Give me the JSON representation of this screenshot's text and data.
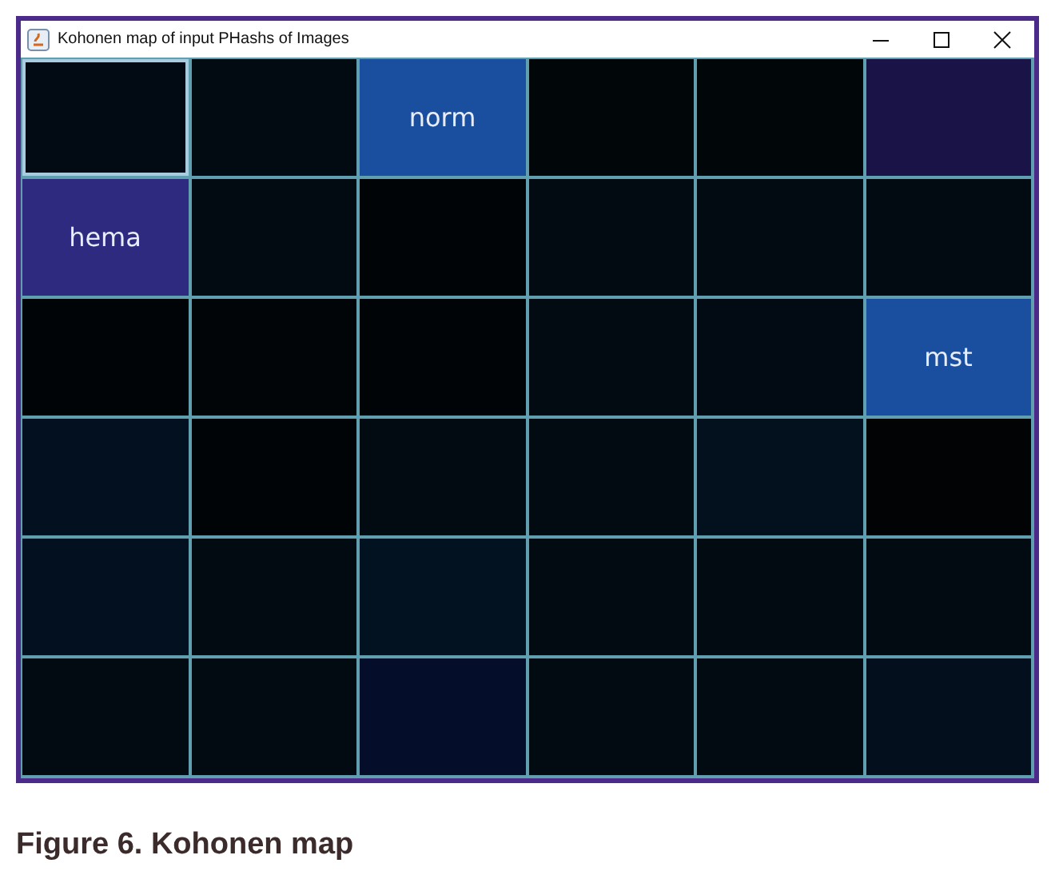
{
  "window": {
    "title": "Kohonen map of input PHashs of Images"
  },
  "map": {
    "rows": [
      [
        {
          "color": "#020b14",
          "selected": true
        },
        {
          "color": "#020a12",
          "selected": false
        },
        {
          "color": "#1a4fa0",
          "label": "norm",
          "selected": false
        },
        {
          "color": "#010609",
          "selected": false
        },
        {
          "color": "#010609",
          "selected": false
        },
        {
          "color": "#1a1347",
          "selected": false
        }
      ],
      [
        {
          "color": "#2e2a80",
          "label": "hema",
          "selected": false
        },
        {
          "color": "#020a12",
          "selected": false
        },
        {
          "color": "#010407",
          "selected": false
        },
        {
          "color": "#020a12",
          "selected": false
        },
        {
          "color": "#020a12",
          "selected": false
        },
        {
          "color": "#020a12",
          "selected": false
        }
      ],
      [
        {
          "color": "#010407",
          "selected": false
        },
        {
          "color": "#010508",
          "selected": false
        },
        {
          "color": "#010407",
          "selected": false
        },
        {
          "color": "#020a12",
          "selected": false
        },
        {
          "color": "#020b14",
          "selected": false
        },
        {
          "color": "#1a4fa0",
          "label": "mst",
          "selected": false
        }
      ],
      [
        {
          "color": "#03101f",
          "selected": false
        },
        {
          "color": "#010407",
          "selected": false
        },
        {
          "color": "#020a12",
          "selected": false
        },
        {
          "color": "#020a12",
          "selected": false
        },
        {
          "color": "#03111f",
          "selected": false
        },
        {
          "color": "#010305",
          "selected": false
        }
      ],
      [
        {
          "color": "#03101f",
          "selected": false
        },
        {
          "color": "#020a12",
          "selected": false
        },
        {
          "color": "#031220",
          "selected": false
        },
        {
          "color": "#020a12",
          "selected": false
        },
        {
          "color": "#020a12",
          "selected": false
        },
        {
          "color": "#020a12",
          "selected": false
        }
      ],
      [
        {
          "color": "#020a12",
          "selected": false
        },
        {
          "color": "#020a12",
          "selected": false
        },
        {
          "color": "#040e2a",
          "selected": false
        },
        {
          "color": "#020a12",
          "selected": false
        },
        {
          "color": "#020a12",
          "selected": false
        },
        {
          "color": "#030f1c",
          "selected": false
        }
      ]
    ]
  },
  "caption": "Figure 6. Kohonen map"
}
